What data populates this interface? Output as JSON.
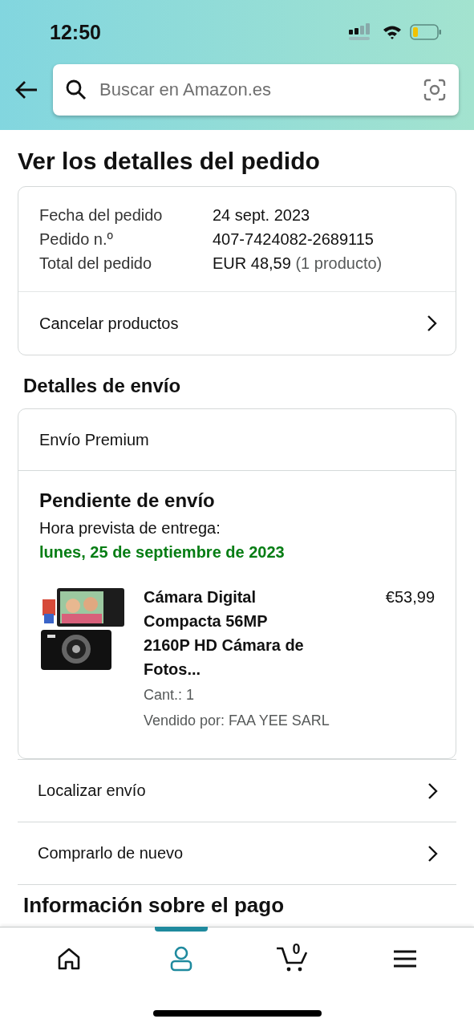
{
  "status_bar": {
    "time": "12:50"
  },
  "search": {
    "placeholder": "Buscar en Amazon.es"
  },
  "page_title": "Ver los detalles del pedido",
  "order_summary": {
    "rows": [
      {
        "label": "Fecha del pedido",
        "value": "24 sept. 2023"
      },
      {
        "label": "Pedido n.º",
        "value": "407-7424082-2689115"
      },
      {
        "label": "Total del pedido",
        "value": "EUR 48,59",
        "note": "(1 producto)"
      }
    ],
    "action": "Cancelar productos"
  },
  "shipping": {
    "heading": "Detalles de envío",
    "method": "Envío Premium",
    "status": "Pendiente de envío",
    "delivery_label": "Hora prevista de entrega:",
    "delivery_date": "lunes, 25 de septiembre de 2023",
    "items": [
      {
        "title": "Cámara Digital Compacta 56MP 2160P HD Cámara de Fotos...",
        "price": "€53,99",
        "quantity": "Cant.: 1",
        "seller": "Vendido por: FAA YEE SARL"
      }
    ]
  },
  "actions": [
    "Localizar envío",
    "Comprarlo de nuevo"
  ],
  "next_section": "Información sobre el pago",
  "bottom_nav": {
    "items": [
      {
        "kind": "home",
        "selected": false
      },
      {
        "kind": "account",
        "selected": true
      },
      {
        "kind": "cart",
        "selected": false,
        "count": "0"
      },
      {
        "kind": "menu",
        "selected": false
      }
    ]
  }
}
